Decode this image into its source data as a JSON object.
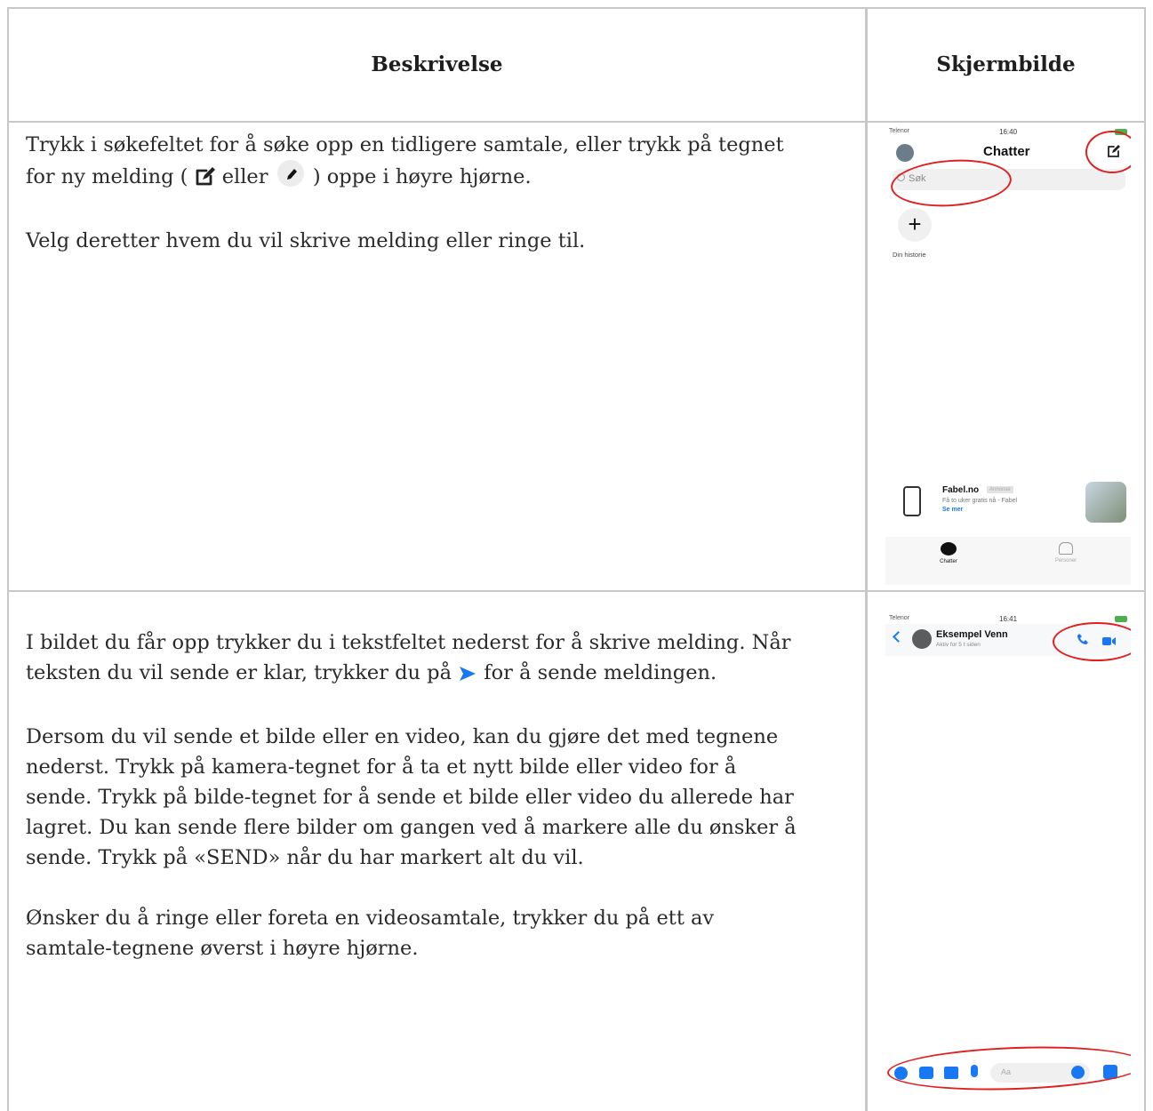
{
  "table": {
    "headers": {
      "description": "Beskrivelse",
      "screenshot": "Skjermbilde"
    }
  },
  "row1": {
    "p1_before": "Trykk i søkefeltet for å søke opp en tidligere samtale, eller trykk på tegnet for ny melding (",
    "p1_mid": "eller",
    "p1_after": ") oppe i høyre hjørne.",
    "p2": "Velg deretter hvem du vil skrive melding eller ringe til."
  },
  "row2": {
    "p1_before": "I bildet du får opp trykker du i tekstfeltet nederst for å skrive melding. Når teksten du vil sende er klar, trykker du på",
    "p1_after": "for å sende meldingen.",
    "p2": "Dersom du vil sende et bilde eller en video, kan du gjøre det med tegnene nederst. Trykk på kamera-tegnet for å ta et nytt bilde eller video for å sende. Trykk på bilde-tegnet for å sende et bilde eller video du allerede har lagret. Du kan sende flere bilder om gangen ved å markere alle du ønsker å sende. Trykk på «SEND» når du har markert alt du vil.",
    "p3": "Ønsker du å ringe eller foreta en videosamtale, trykker du på ett av samtale-tegnene øverst i høyre hjørne."
  },
  "phone1": {
    "carrier": "Telenor",
    "time": "16:40",
    "title": "Chatter",
    "search_placeholder": "Søk",
    "story_label": "Din historie",
    "ad_name": "Fabel.no",
    "ad_badge": "Annonse",
    "ad_text": "Få to uker gratis nå - Fabel",
    "ad_link": "Se mer",
    "tab_chats": "Chatter",
    "tab_people": "Personer"
  },
  "phone2": {
    "carrier": "Telenor",
    "time": "16:41",
    "contact_name": "Eksempel Venn",
    "contact_status": "Aktiv for 5 t siden",
    "input_placeholder": "Aa"
  },
  "colors": {
    "messenger_blue": "#1877f2",
    "highlight_red": "#e02020",
    "grid": "#c8c8c8"
  }
}
